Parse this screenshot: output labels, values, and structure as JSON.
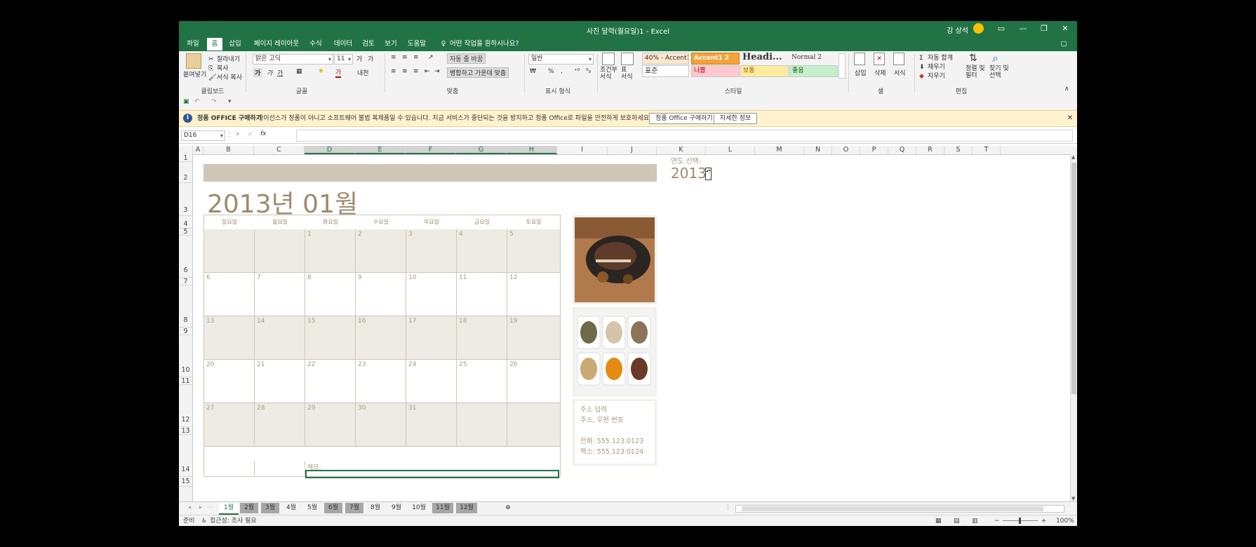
{
  "title": "사진 달력(월요일)1  -  Excel",
  "user": "강 상석",
  "ribbon_tabs": [
    "파일",
    "홈",
    "삽입",
    "페이지 레이아웃",
    "수식",
    "데이터",
    "검토",
    "보기",
    "도움말"
  ],
  "tell_me": "어떤 작업을 원하시나요?",
  "clipboard": {
    "paste": "붙여넣기",
    "cut": "잘라내기",
    "copy": "복사",
    "format_painter": "서식 복사",
    "label": "클립보드"
  },
  "font": {
    "name": "맑은 고딕",
    "size": "11",
    "label": "글꼴",
    "bold": "가",
    "italic": "가",
    "underline": "가",
    "grow": "가",
    "shrink": "가",
    "color_glyph": "가",
    "phonetic": "내천"
  },
  "alignment": {
    "wrap": "자동 줄 바꿈",
    "merge": "병합하고 가운데 맞춤",
    "label": "맞춤"
  },
  "number": {
    "format": "일반",
    "label": "표시 형식",
    "percent": "%",
    "comma": ","
  },
  "styles": {
    "conditional": "조건부 서식",
    "table": "표 서식",
    "label": "스타일",
    "items": [
      "40% - Accent1 2",
      "Accent1 2",
      "Headi...",
      "Normal 2",
      "표준",
      "나쁨",
      "보통",
      "좋음"
    ]
  },
  "cells": {
    "insert": "삽입",
    "delete": "삭제",
    "format": "서식",
    "label": "셀"
  },
  "editing": {
    "autosum": "자동 합계",
    "fill": "채우기",
    "clear": "지우기",
    "sort": "정렬 및 필터",
    "find": "찾기 및 선택",
    "label": "편집"
  },
  "message": {
    "title": "정품 OFFICE 구매하기",
    "text": "라이선스가 정품이 아니고 소프트웨어 불법 복제품일 수 있습니다. 지금 서비스가 중단되는 것을 방지하고 정품 Office로 파일을 안전하게 보호하세요.",
    "buy": "정품 Office 구매하기",
    "more": "자세한 정보"
  },
  "namebox": "D16",
  "fx": "fx",
  "columns": [
    "A",
    "B",
    "C",
    "D",
    "E",
    "F",
    "G",
    "H",
    "I",
    "J",
    "K",
    "L",
    "M",
    "N",
    "O",
    "P",
    "Q",
    "R",
    "S",
    "T"
  ],
  "rows": [
    "1",
    "2",
    "3",
    "4",
    "5",
    "6",
    "7",
    "8",
    "9",
    "10",
    "11",
    "12",
    "13",
    "14",
    "15"
  ],
  "calendar": {
    "heading": "2013년 01월",
    "weekdays": [
      "일요일",
      "월요일",
      "화요일",
      "수요일",
      "목요일",
      "금요일",
      "토요일"
    ],
    "weeks": [
      [
        "",
        "",
        "1",
        "2",
        "3",
        "4",
        "5"
      ],
      [
        "6",
        "7",
        "8",
        "9",
        "10",
        "11",
        "12"
      ],
      [
        "13",
        "14",
        "15",
        "16",
        "17",
        "18",
        "19"
      ],
      [
        "20",
        "21",
        "22",
        "23",
        "24",
        "25",
        "26"
      ],
      [
        "27",
        "28",
        "29",
        "30",
        "31",
        "",
        ""
      ]
    ],
    "memo": "메모:"
  },
  "year_label": "연도 선택:",
  "year_value": "2013",
  "address": [
    "주소 입력",
    "주소, 우편 번호",
    "",
    "전화: 555.123.0123",
    "팩스: 555.123.0124"
  ],
  "sheet_tabs": [
    "1월",
    "2월",
    "3월",
    "4월",
    "5월",
    "6월",
    "7월",
    "8월",
    "9월",
    "10월",
    "11월",
    "12월"
  ],
  "status": {
    "ready": "준비",
    "accessibility": "접근성: 조사 필요",
    "zoom": "100%"
  }
}
